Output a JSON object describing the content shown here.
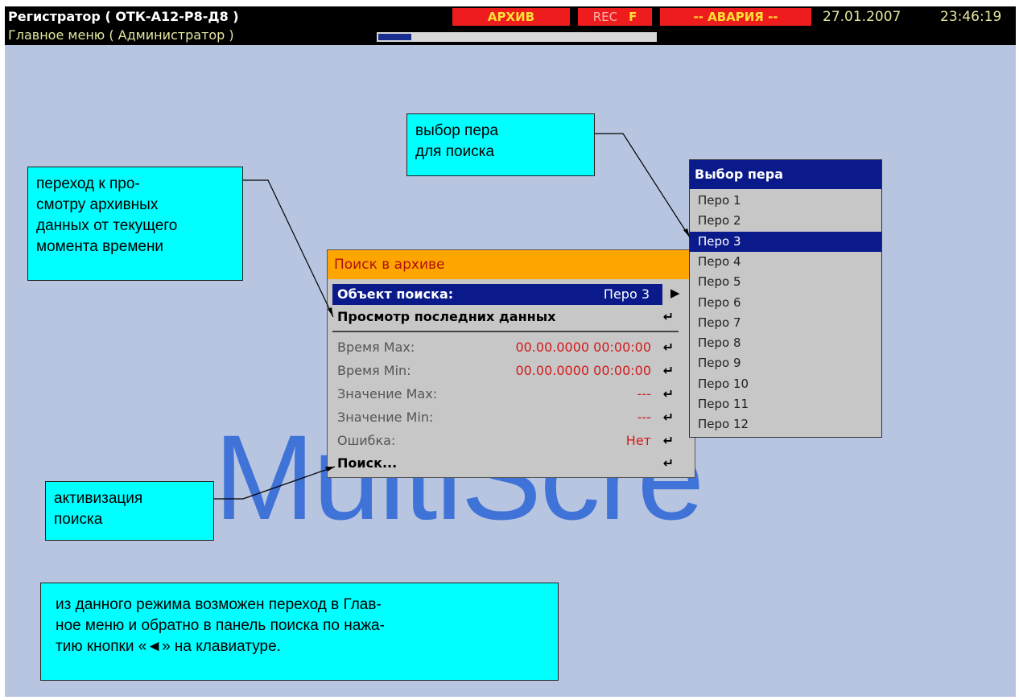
{
  "header": {
    "title": "Регистратор ( ОТК-А12-Р8-Д8 )",
    "subtitle": "Главное меню ( Администратор )",
    "status_archive": "АРХИВ",
    "status_rec": "REC",
    "status_rec_flag": "F",
    "status_alarm": "-- АВАРИЯ --",
    "date": "27.01.2007",
    "time": "23:46:19",
    "progress": 0.12
  },
  "watermark": "MultiScre",
  "search_dialog": {
    "title": "Поиск в архиве",
    "object_label": "Объект поиска:",
    "object_value": "Перо 3",
    "last_data_label": "Просмотр последних данных",
    "time_max_label": "Время Max:",
    "time_max_value": "00.00.0000 00:00:00",
    "time_min_label": "Время Min:",
    "time_min_value": "00.00.0000 00:00:00",
    "value_max_label": "Значение Max:",
    "value_max_value": "---",
    "value_min_label": "Значение Min:",
    "value_min_value": "---",
    "error_label": "Ошибка:",
    "error_value": "Нет",
    "search_label": "Поиск..."
  },
  "pen_list": {
    "title": "Выбор пера",
    "selected_index": 2,
    "items": [
      "Перо 1",
      "Перо 2",
      "Перо 3",
      "Перо 4",
      "Перо 5",
      "Перо 6",
      "Перо 7",
      "Перо 8",
      "Перо 9",
      "Перо 10",
      "Перо 11",
      "Перо 12"
    ]
  },
  "callouts": {
    "pen": [
      "выбор пера",
      "для поиска"
    ],
    "history": [
      "переход к про-",
      "смотру архивных",
      "данных от текущего",
      "момента времени"
    ],
    "search": [
      "активизация",
      "поиска"
    ],
    "info": [
      "из данного режима возможен переход в Глав-",
      "ное меню и обратно в панель поиска по нажа-",
      "тию кнопки «◄» на клавиатуре."
    ]
  },
  "colors": {
    "screen_bg": "#b7c5e0",
    "callout_bg": "#00ffff",
    "dialog_header": "#ffa500",
    "selection": "#0a1a8a",
    "alarm_red": "#ee1c1c"
  }
}
